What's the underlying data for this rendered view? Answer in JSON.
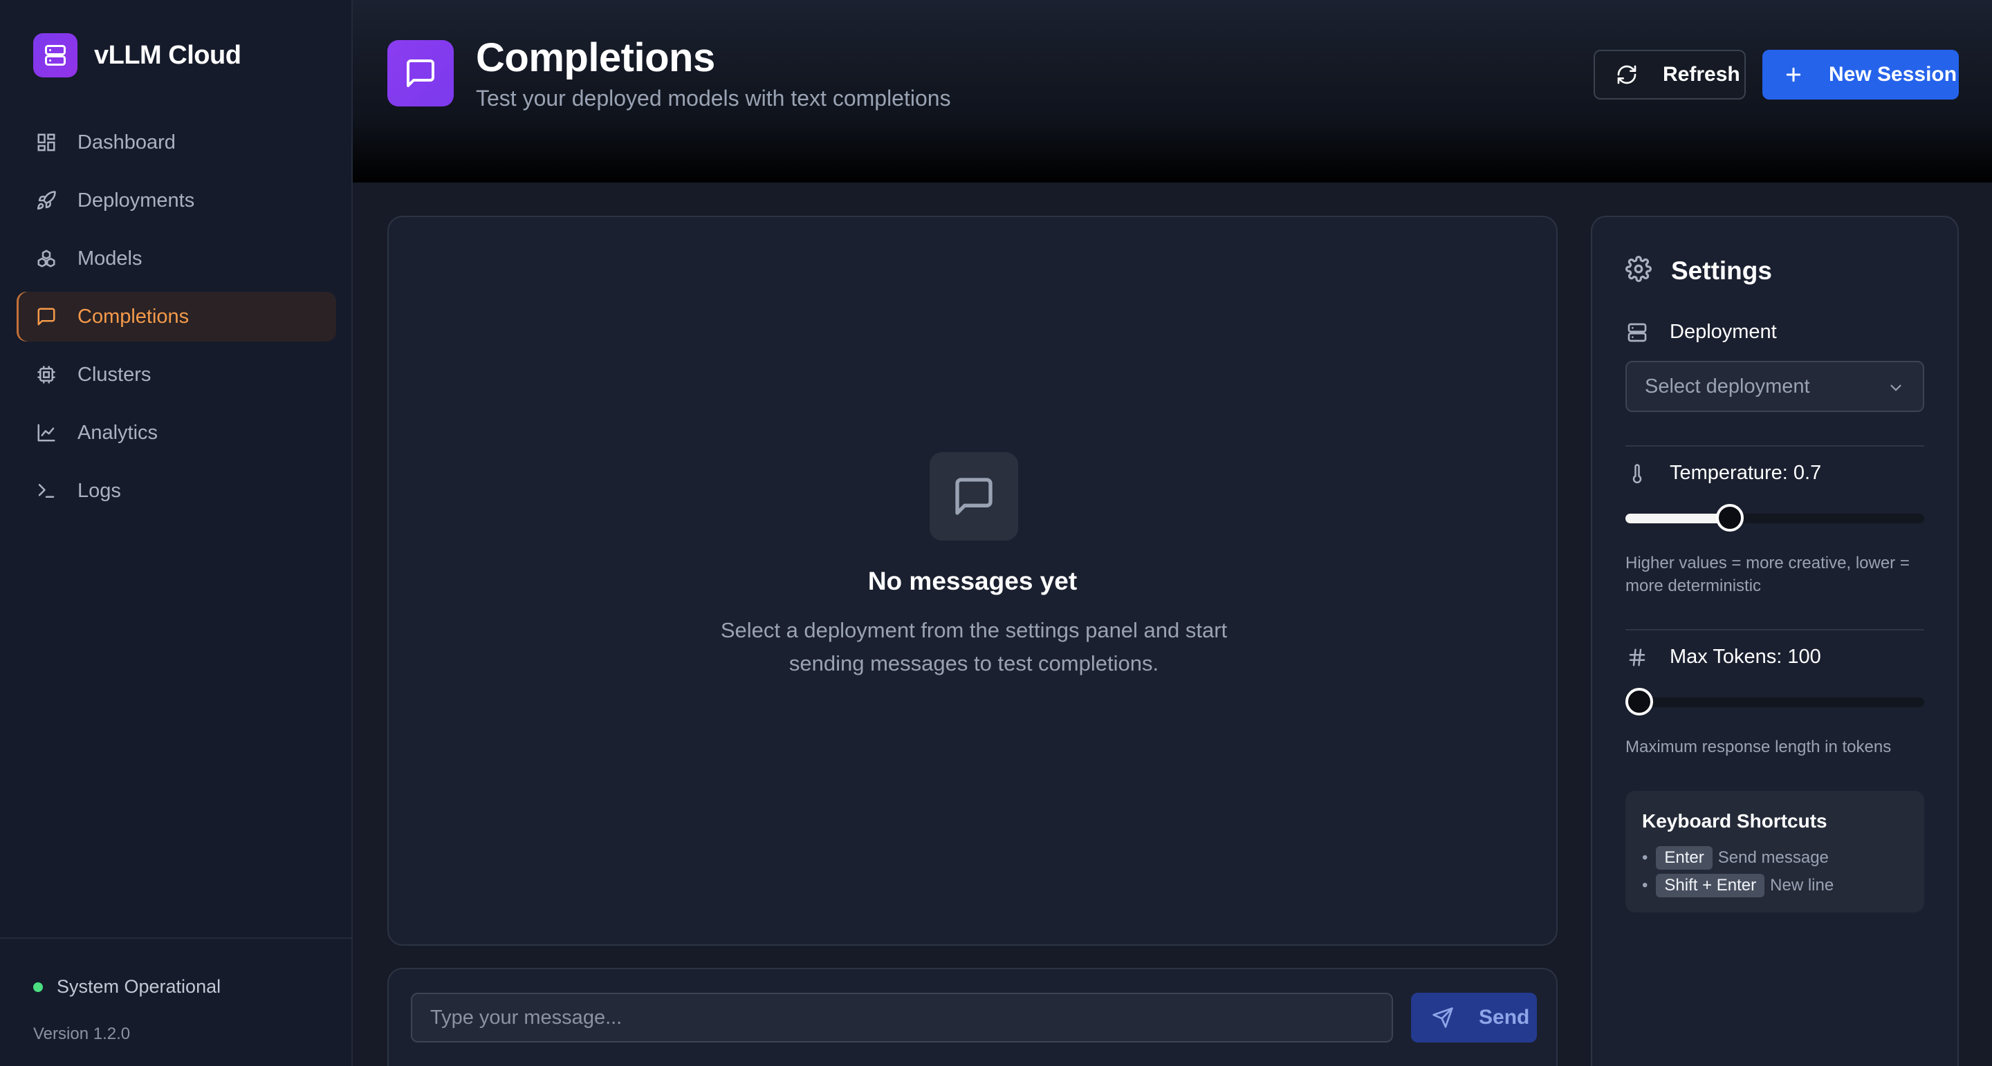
{
  "brand": {
    "name": "vLLM Cloud",
    "icon": "server-icon"
  },
  "sidebar": {
    "items": [
      {
        "label": "Dashboard",
        "icon": "dashboard-icon",
        "active": false
      },
      {
        "label": "Deployments",
        "icon": "rocket-icon",
        "active": false
      },
      {
        "label": "Models",
        "icon": "boxes-icon",
        "active": false
      },
      {
        "label": "Completions",
        "icon": "message-square-icon",
        "active": true
      },
      {
        "label": "Clusters",
        "icon": "cpu-icon",
        "active": false
      },
      {
        "label": "Analytics",
        "icon": "line-chart-icon",
        "active": false
      },
      {
        "label": "Logs",
        "icon": "terminal-icon",
        "active": false
      }
    ],
    "status": "System Operational",
    "status_color": "#4ade80",
    "version": "Version 1.2.0"
  },
  "header": {
    "title": "Completions",
    "subtitle": "Test your deployed models with text completions",
    "refresh_label": "Refresh",
    "new_session_label": "New Session"
  },
  "chat": {
    "empty_title": "No messages yet",
    "empty_text": "Select a deployment from the settings panel and start sending messages to test completions.",
    "input_placeholder": "Type your message...",
    "send_label": "Send"
  },
  "settings": {
    "title": "Settings",
    "deployment_label": "Deployment",
    "deployment_placeholder": "Select deployment",
    "temperature_label": "Temperature: 0.7",
    "temperature_value": 0.7,
    "temperature_max": 2,
    "temperature_hint": "Higher values = more creative, lower = more deterministic",
    "max_tokens_label": "Max Tokens: 100",
    "max_tokens_value": 100,
    "max_tokens_min": 1,
    "max_tokens_max": 4096,
    "max_tokens_hint": "Maximum response length in tokens",
    "shortcuts_title": "Keyboard Shortcuts",
    "shortcuts": [
      {
        "key": "Enter",
        "desc": "Send message"
      },
      {
        "key": "Shift + Enter",
        "desc": "New line"
      }
    ]
  },
  "colors": {
    "accent": "#2563eb",
    "active_nav": "#f59a4a",
    "brand": "#7c3aed"
  }
}
